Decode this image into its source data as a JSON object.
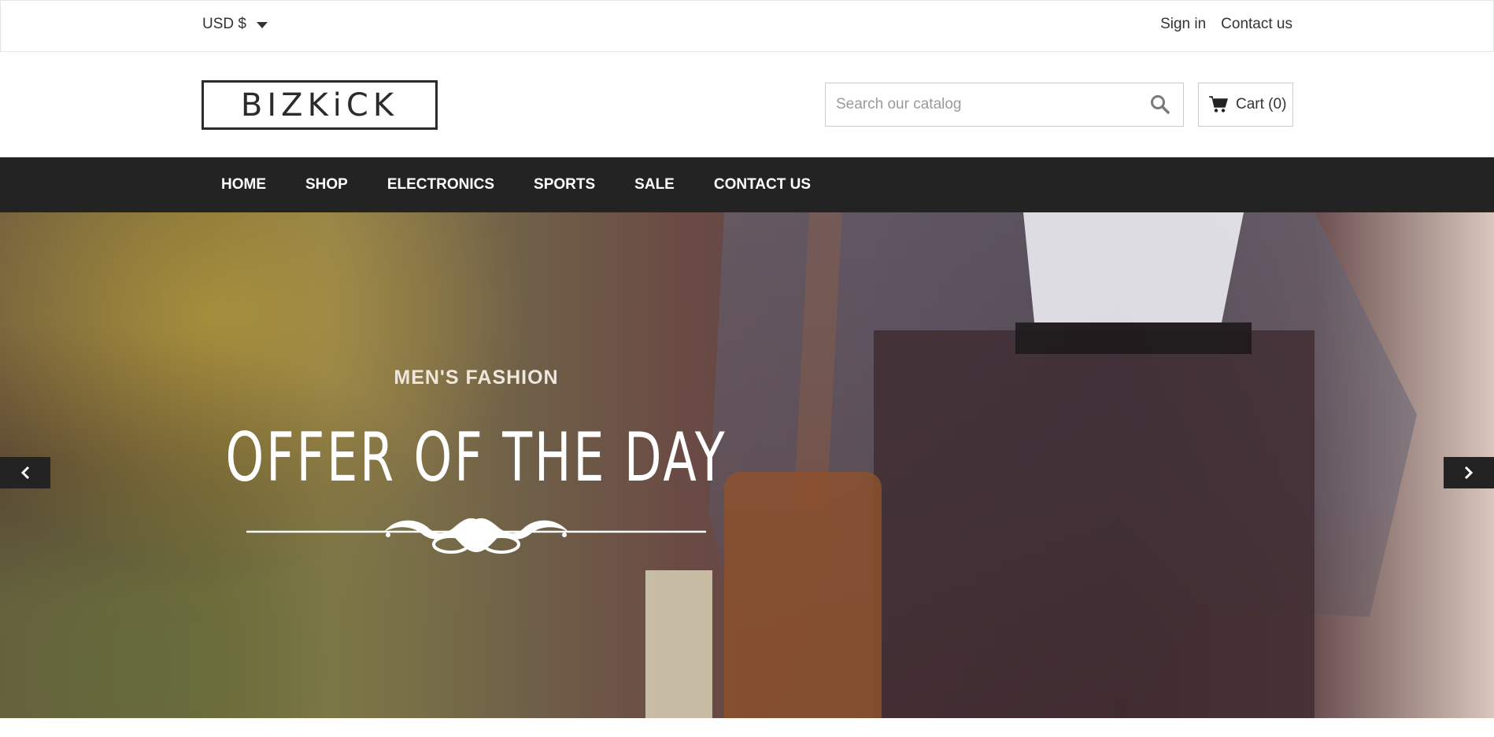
{
  "topbar": {
    "currency": "USD $",
    "sign_in": "Sign in",
    "contact_us": "Contact us"
  },
  "header": {
    "logo_text": "BIZKiCK",
    "search_placeholder": "Search our catalog",
    "cart_label": "Cart (0)"
  },
  "nav": {
    "items": [
      {
        "label": "HOME"
      },
      {
        "label": "SHOP"
      },
      {
        "label": "ELECTRONICS"
      },
      {
        "label": "SPORTS"
      },
      {
        "label": "SALE"
      },
      {
        "label": "CONTACT US"
      }
    ]
  },
  "hero": {
    "subtitle": "MEN'S FASHION",
    "title": "OFFER OF THE DAY"
  },
  "icons": {
    "currency_caret": "caret-down-icon",
    "search": "search-icon",
    "cart": "cart-icon",
    "prev": "chevron-left-icon",
    "next": "chevron-right-icon"
  },
  "colors": {
    "nav_bg": "#232323",
    "nav_text": "#ffffff",
    "text": "#333333"
  }
}
